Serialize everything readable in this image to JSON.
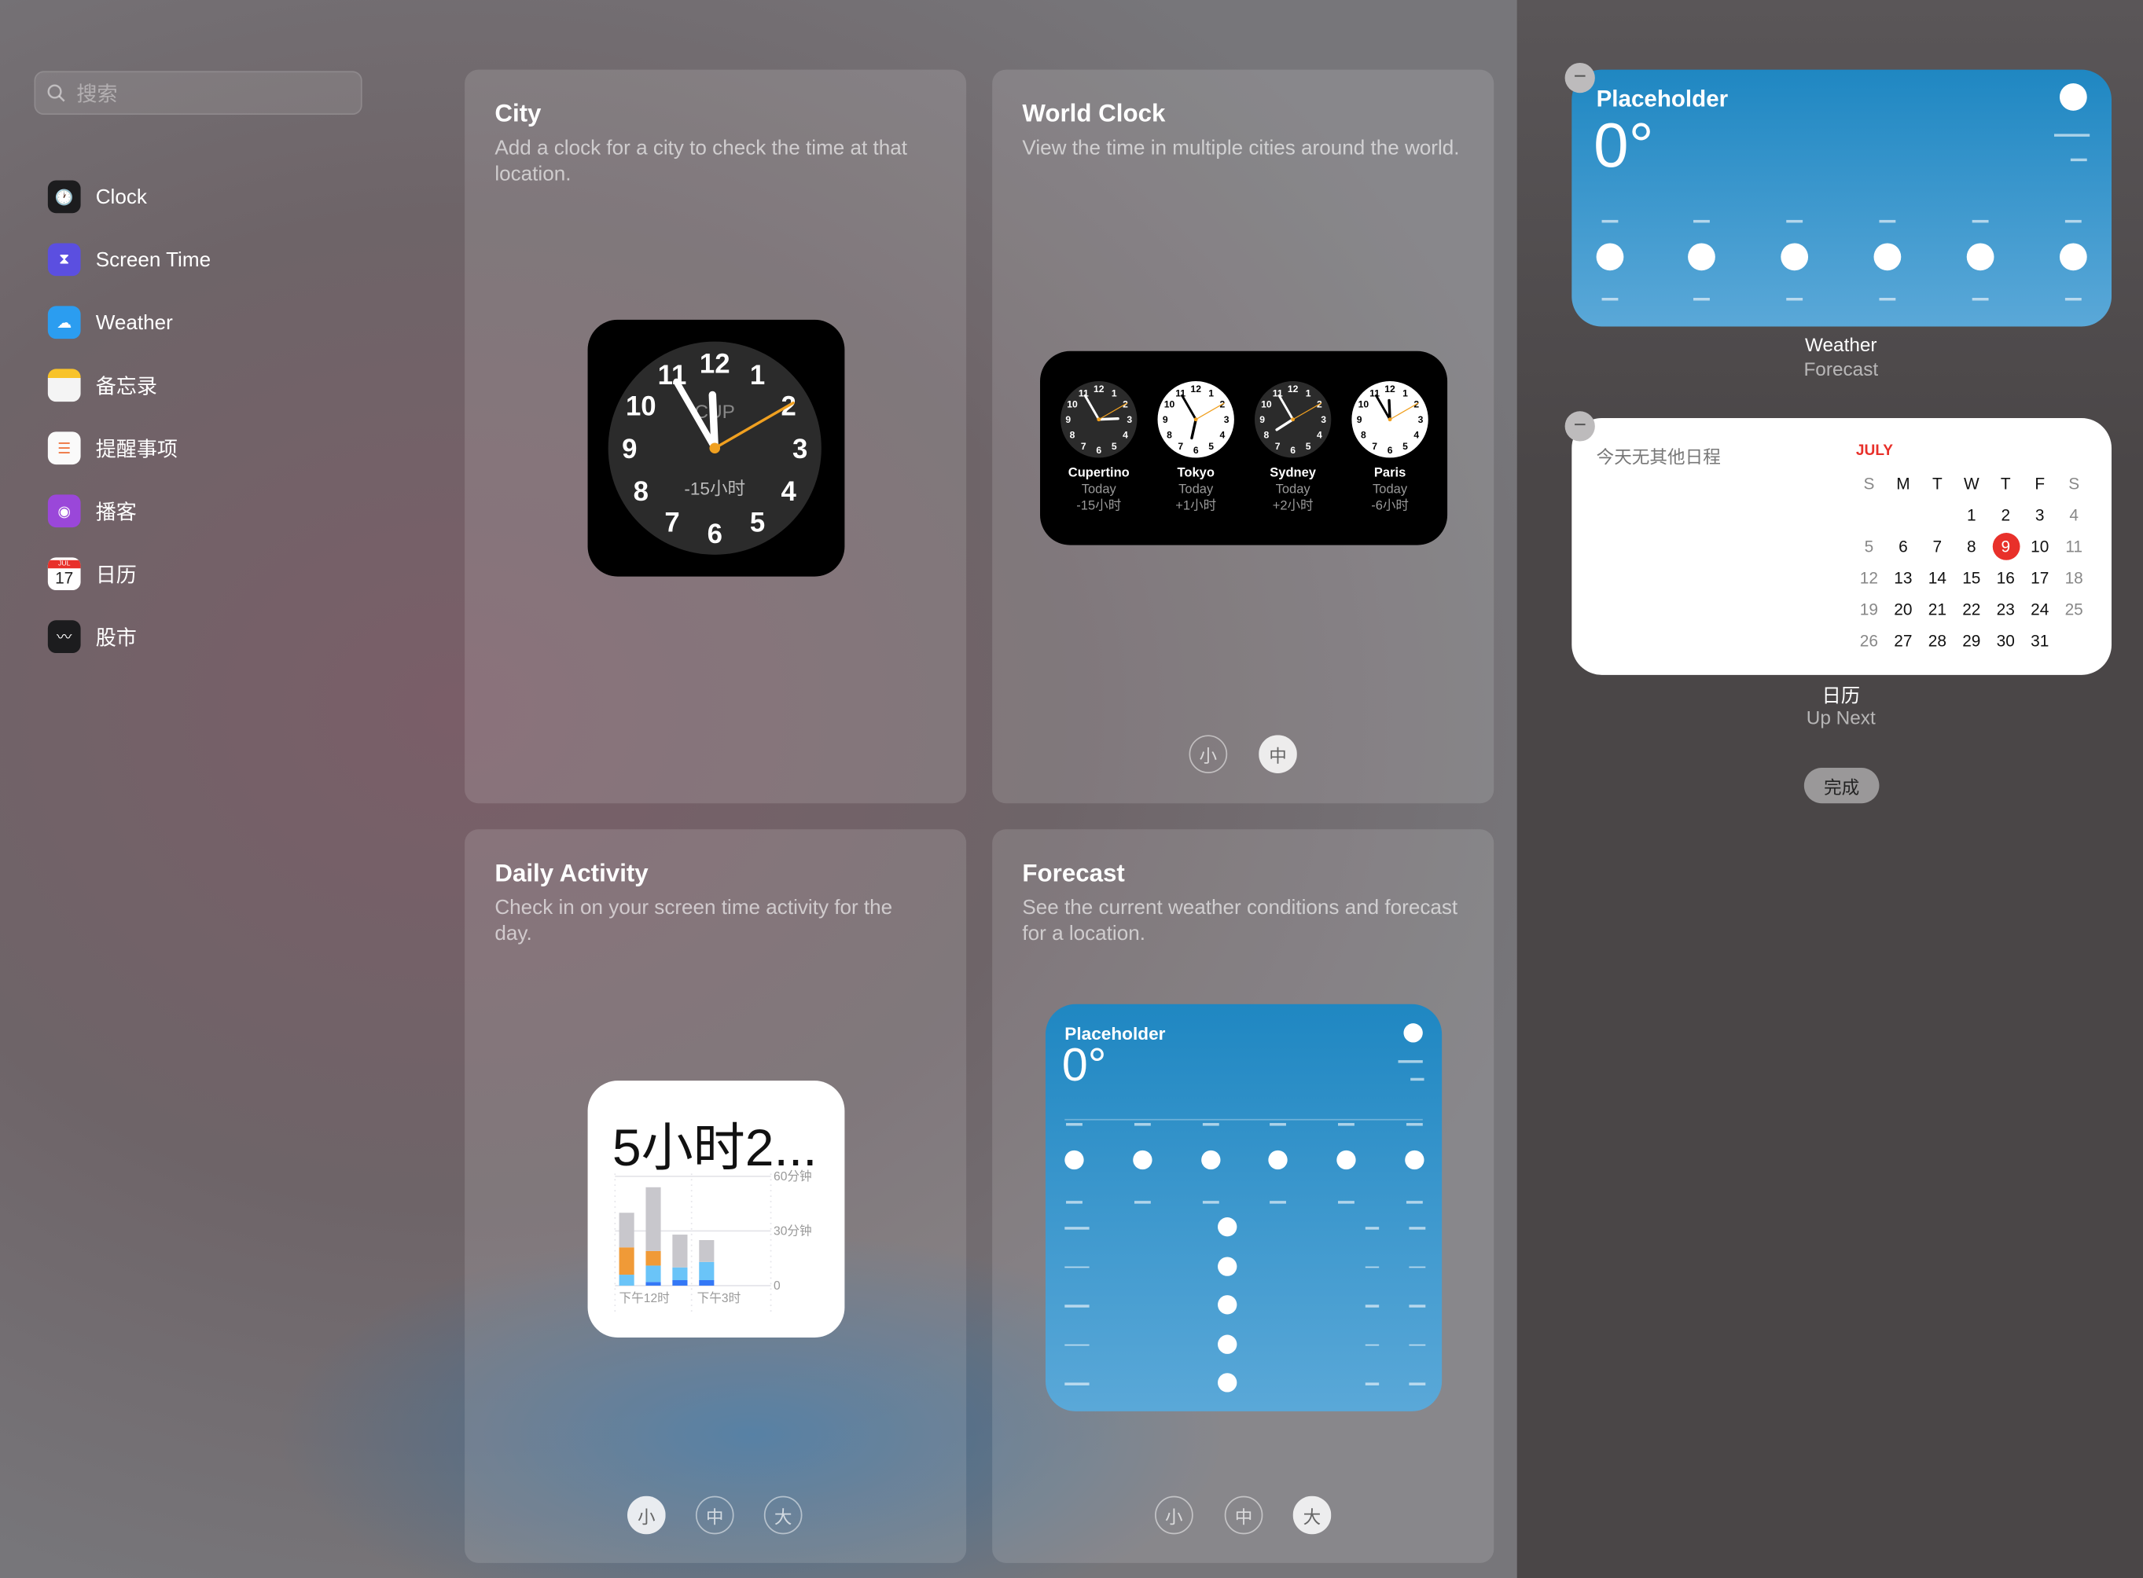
{
  "search": {
    "placeholder": "搜索",
    "icon": "search-icon"
  },
  "sidebar": {
    "items": [
      {
        "label": "Clock",
        "icon": "clock-app-icon"
      },
      {
        "label": "Screen Time",
        "icon": "hourglass-icon"
      },
      {
        "label": "Weather",
        "icon": "weather-icon"
      },
      {
        "label": "备忘录",
        "icon": "notes-icon"
      },
      {
        "label": "提醒事项",
        "icon": "reminders-icon"
      },
      {
        "label": "播客",
        "icon": "podcasts-icon"
      },
      {
        "label": "日历",
        "icon": "calendar-icon",
        "icon_month": "JUL",
        "icon_day": "17"
      },
      {
        "label": "股市",
        "icon": "stocks-icon"
      }
    ]
  },
  "cards": {
    "city": {
      "title": "City",
      "desc": "Add a clock for a city to check the time at that location.",
      "clock_city": "CUP",
      "clock_offset": "-15小时"
    },
    "world": {
      "title": "World Clock",
      "desc": "View the time in multiple cities around the world.",
      "cities": [
        {
          "name": "Cupertino",
          "day": "Today",
          "offset": "-15小时",
          "dark": true
        },
        {
          "name": "Tokyo",
          "day": "Today",
          "offset": "+1小时",
          "dark": false
        },
        {
          "name": "Sydney",
          "day": "Today",
          "offset": "+2小时",
          "dark": true
        },
        {
          "name": "Paris",
          "day": "Today",
          "offset": "-6小时",
          "dark": false
        }
      ],
      "sizes": [
        "小",
        "中"
      ],
      "selected_size": "中"
    },
    "daily": {
      "title": "Daily Activity",
      "desc": "Check in on your screen time activity for the day.",
      "total": "5小时2...",
      "y_labels": [
        "60分钟",
        "30分钟",
        "0"
      ],
      "x_labels": [
        "下午12时",
        "下午3时"
      ],
      "bars_minutes": [
        {
          "gray": 19,
          "orange": 15,
          "light_blue": 6,
          "blue": 0
        },
        {
          "gray": 35,
          "orange": 8,
          "light_blue": 9,
          "blue": 2
        },
        {
          "gray": 18,
          "orange": 0,
          "light_blue": 7,
          "blue": 3
        },
        {
          "gray": 12,
          "orange": 0,
          "light_blue": 10,
          "blue": 3
        }
      ],
      "colors": {
        "gray": "#c8c7cc",
        "orange": "#f09a37",
        "light_blue": "#6ac4f8",
        "blue": "#3478f6"
      },
      "sizes": [
        "小",
        "中",
        "大"
      ],
      "selected_size": "小"
    },
    "forecast": {
      "title": "Forecast",
      "desc": "See the current weather conditions and forecast for a location.",
      "location": "Placeholder",
      "temp": "0°",
      "sizes": [
        "小",
        "中",
        "大"
      ],
      "selected_size": "大"
    }
  },
  "right": {
    "weather": {
      "location": "Placeholder",
      "temp": "0°",
      "name": "Weather",
      "kind": "Forecast"
    },
    "calendar": {
      "no_events": "今天无其他日程",
      "month": "JULY",
      "weekdays": [
        "S",
        "M",
        "T",
        "W",
        "T",
        "F",
        "S"
      ],
      "weeks": [
        [
          "",
          "",
          "",
          "1",
          "2",
          "3",
          "4"
        ],
        [
          "5",
          "6",
          "7",
          "8",
          "9",
          "10",
          "11"
        ],
        [
          "12",
          "13",
          "14",
          "15",
          "16",
          "17",
          "18"
        ],
        [
          "19",
          "20",
          "21",
          "22",
          "23",
          "24",
          "25"
        ],
        [
          "26",
          "27",
          "28",
          "29",
          "30",
          "31",
          ""
        ]
      ],
      "today": "9",
      "name": "日历",
      "kind": "Up Next"
    },
    "done_label": "完成"
  }
}
